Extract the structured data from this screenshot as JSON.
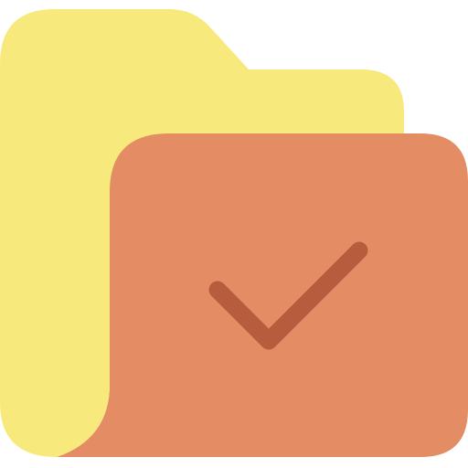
{
  "icon": {
    "name": "folder-check-icon",
    "colors": {
      "folder_back": "#F7E97C",
      "folder_front": "#E48C63",
      "checkmark": "#B85C3E",
      "background": "#FFFFFF"
    }
  }
}
